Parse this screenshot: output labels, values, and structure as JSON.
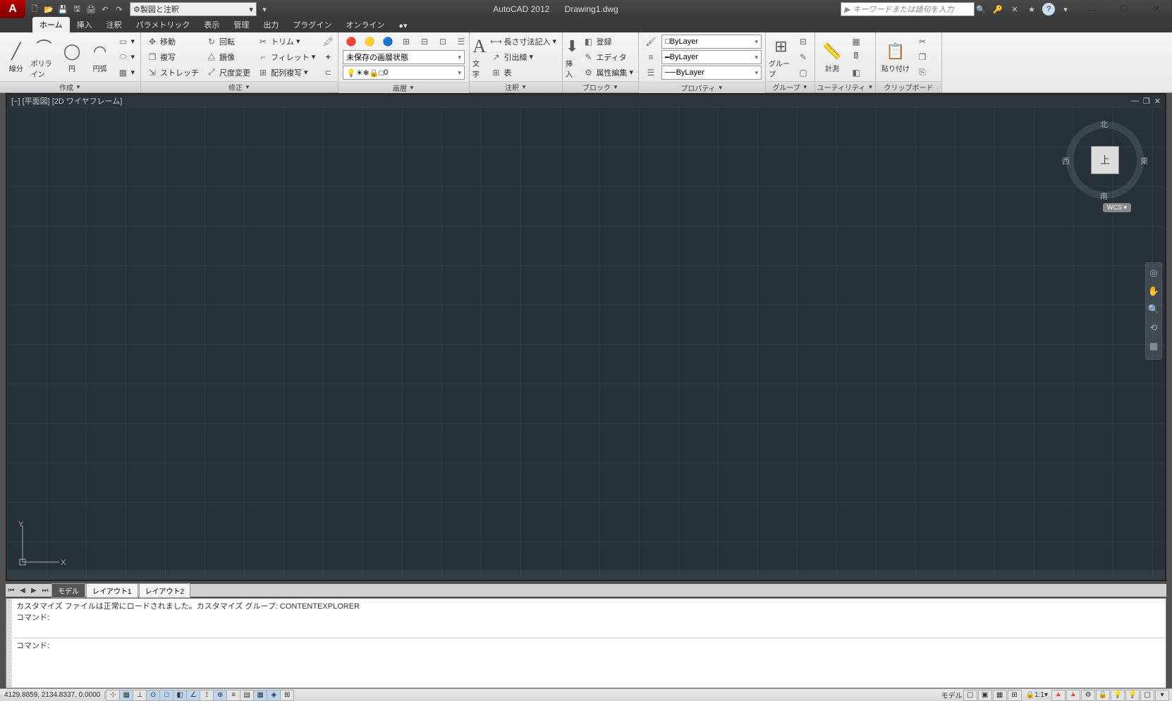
{
  "title": {
    "app": "AutoCAD 2012",
    "file": "Drawing1.dwg"
  },
  "search": {
    "placeholder": "キーワードまたは語句を入力"
  },
  "workspace": {
    "current": "製図と注釈"
  },
  "tabs": {
    "home": "ホーム",
    "insert": "挿入",
    "annotate": "注釈",
    "parametric": "パラメトリック",
    "view": "表示",
    "manage": "管理",
    "output": "出力",
    "plugins": "プラグイン",
    "online": "オンライン"
  },
  "panels": {
    "draw": "作成",
    "modify": "修正",
    "layers": "画層",
    "annotation": "注釈",
    "block": "ブロック",
    "properties": "プロパティ",
    "groups": "グループ",
    "utilities": "ユーティリティ",
    "clipboard": "クリップボード"
  },
  "cmds": {
    "line": "線分",
    "polyline": "ポリライン",
    "circle": "円",
    "arc": "円弧",
    "move": "移動",
    "copy": "複写",
    "stretch": "ストレッチ",
    "rotate": "回転",
    "mirror": "鏡像",
    "scale": "尺度変更",
    "trim": "トリム",
    "fillet": "フィレット",
    "array": "配列複写",
    "unsaved_layer": "未保存の画層状態",
    "layer0": "0",
    "text": "文字",
    "dim_linear": "長さ寸法記入",
    "leader": "引出線",
    "table": "表",
    "insert": "挿入",
    "create": "登録",
    "edit": "エディタ",
    "attedit": "属性編集",
    "bylayer": "ByLayer",
    "group": "グループ",
    "measure": "計測",
    "paste": "貼り付け"
  },
  "viewport": {
    "label": "[−] [平面図] [2D ワイヤフレーム]",
    "cube": {
      "top": "上",
      "n": "北",
      "s": "南",
      "e": "東",
      "w": "西"
    },
    "wcs": "WCS"
  },
  "layout": {
    "model": "モデル",
    "l1": "レイアウト1",
    "l2": "レイアウト2"
  },
  "cmdwin": {
    "hist": "カスタマイズ ファイルは正常にロードされました。カスタマイズ グループ: CONTENTEXPLORER\nコマンド:",
    "prompt": "コマンド:"
  },
  "status": {
    "coords": "4129.8859, 2134.8337, 0.0000",
    "model": "モデル",
    "scale": "1:1"
  }
}
